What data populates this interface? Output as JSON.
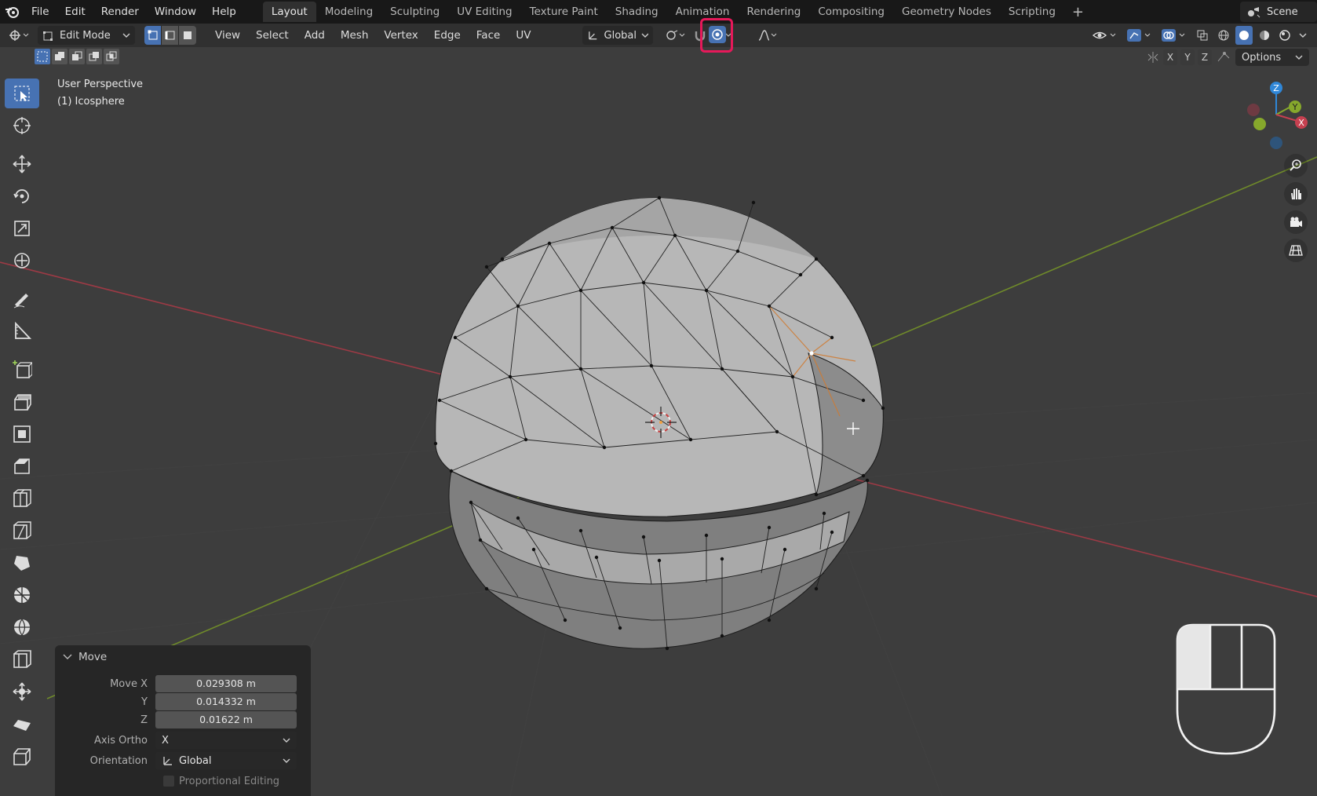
{
  "menubar": {
    "items": [
      "File",
      "Edit",
      "Render",
      "Window",
      "Help"
    ],
    "workspaces": [
      "Layout",
      "Modeling",
      "Sculpting",
      "UV Editing",
      "Texture Paint",
      "Shading",
      "Animation",
      "Rendering",
      "Compositing",
      "Geometry Nodes",
      "Scripting"
    ],
    "active_workspace": "Layout",
    "add_tab": "+",
    "scene_label": "Scene"
  },
  "header": {
    "mode": "Edit Mode",
    "menus": [
      "View",
      "Select",
      "Add",
      "Mesh",
      "Vertex",
      "Edge",
      "Face",
      "UV"
    ],
    "orientation": "Global"
  },
  "gizmo_axes": {
    "x": "X",
    "y": "Y",
    "z": "Z"
  },
  "options_label": "Options",
  "viewport": {
    "view_name": "User Perspective",
    "object_name": "(1) Icosphere"
  },
  "operator_panel": {
    "title": "Move",
    "move_x_label": "Move X",
    "move_x": "0.029308 m",
    "y_label": "Y",
    "y": "0.014332 m",
    "z_label": "Z",
    "z": "0.01622 m",
    "axis_ortho_label": "Axis Ortho",
    "axis_ortho": "X",
    "orientation_label": "Orientation",
    "orientation": "Global",
    "proportional_label": "Proportional Editing"
  },
  "colors": {
    "accent": "#4772b3",
    "highlight": "#e6195a",
    "x_axis": "#c64050",
    "y_axis": "#86a82c",
    "z_axis": "#2f87d8"
  }
}
